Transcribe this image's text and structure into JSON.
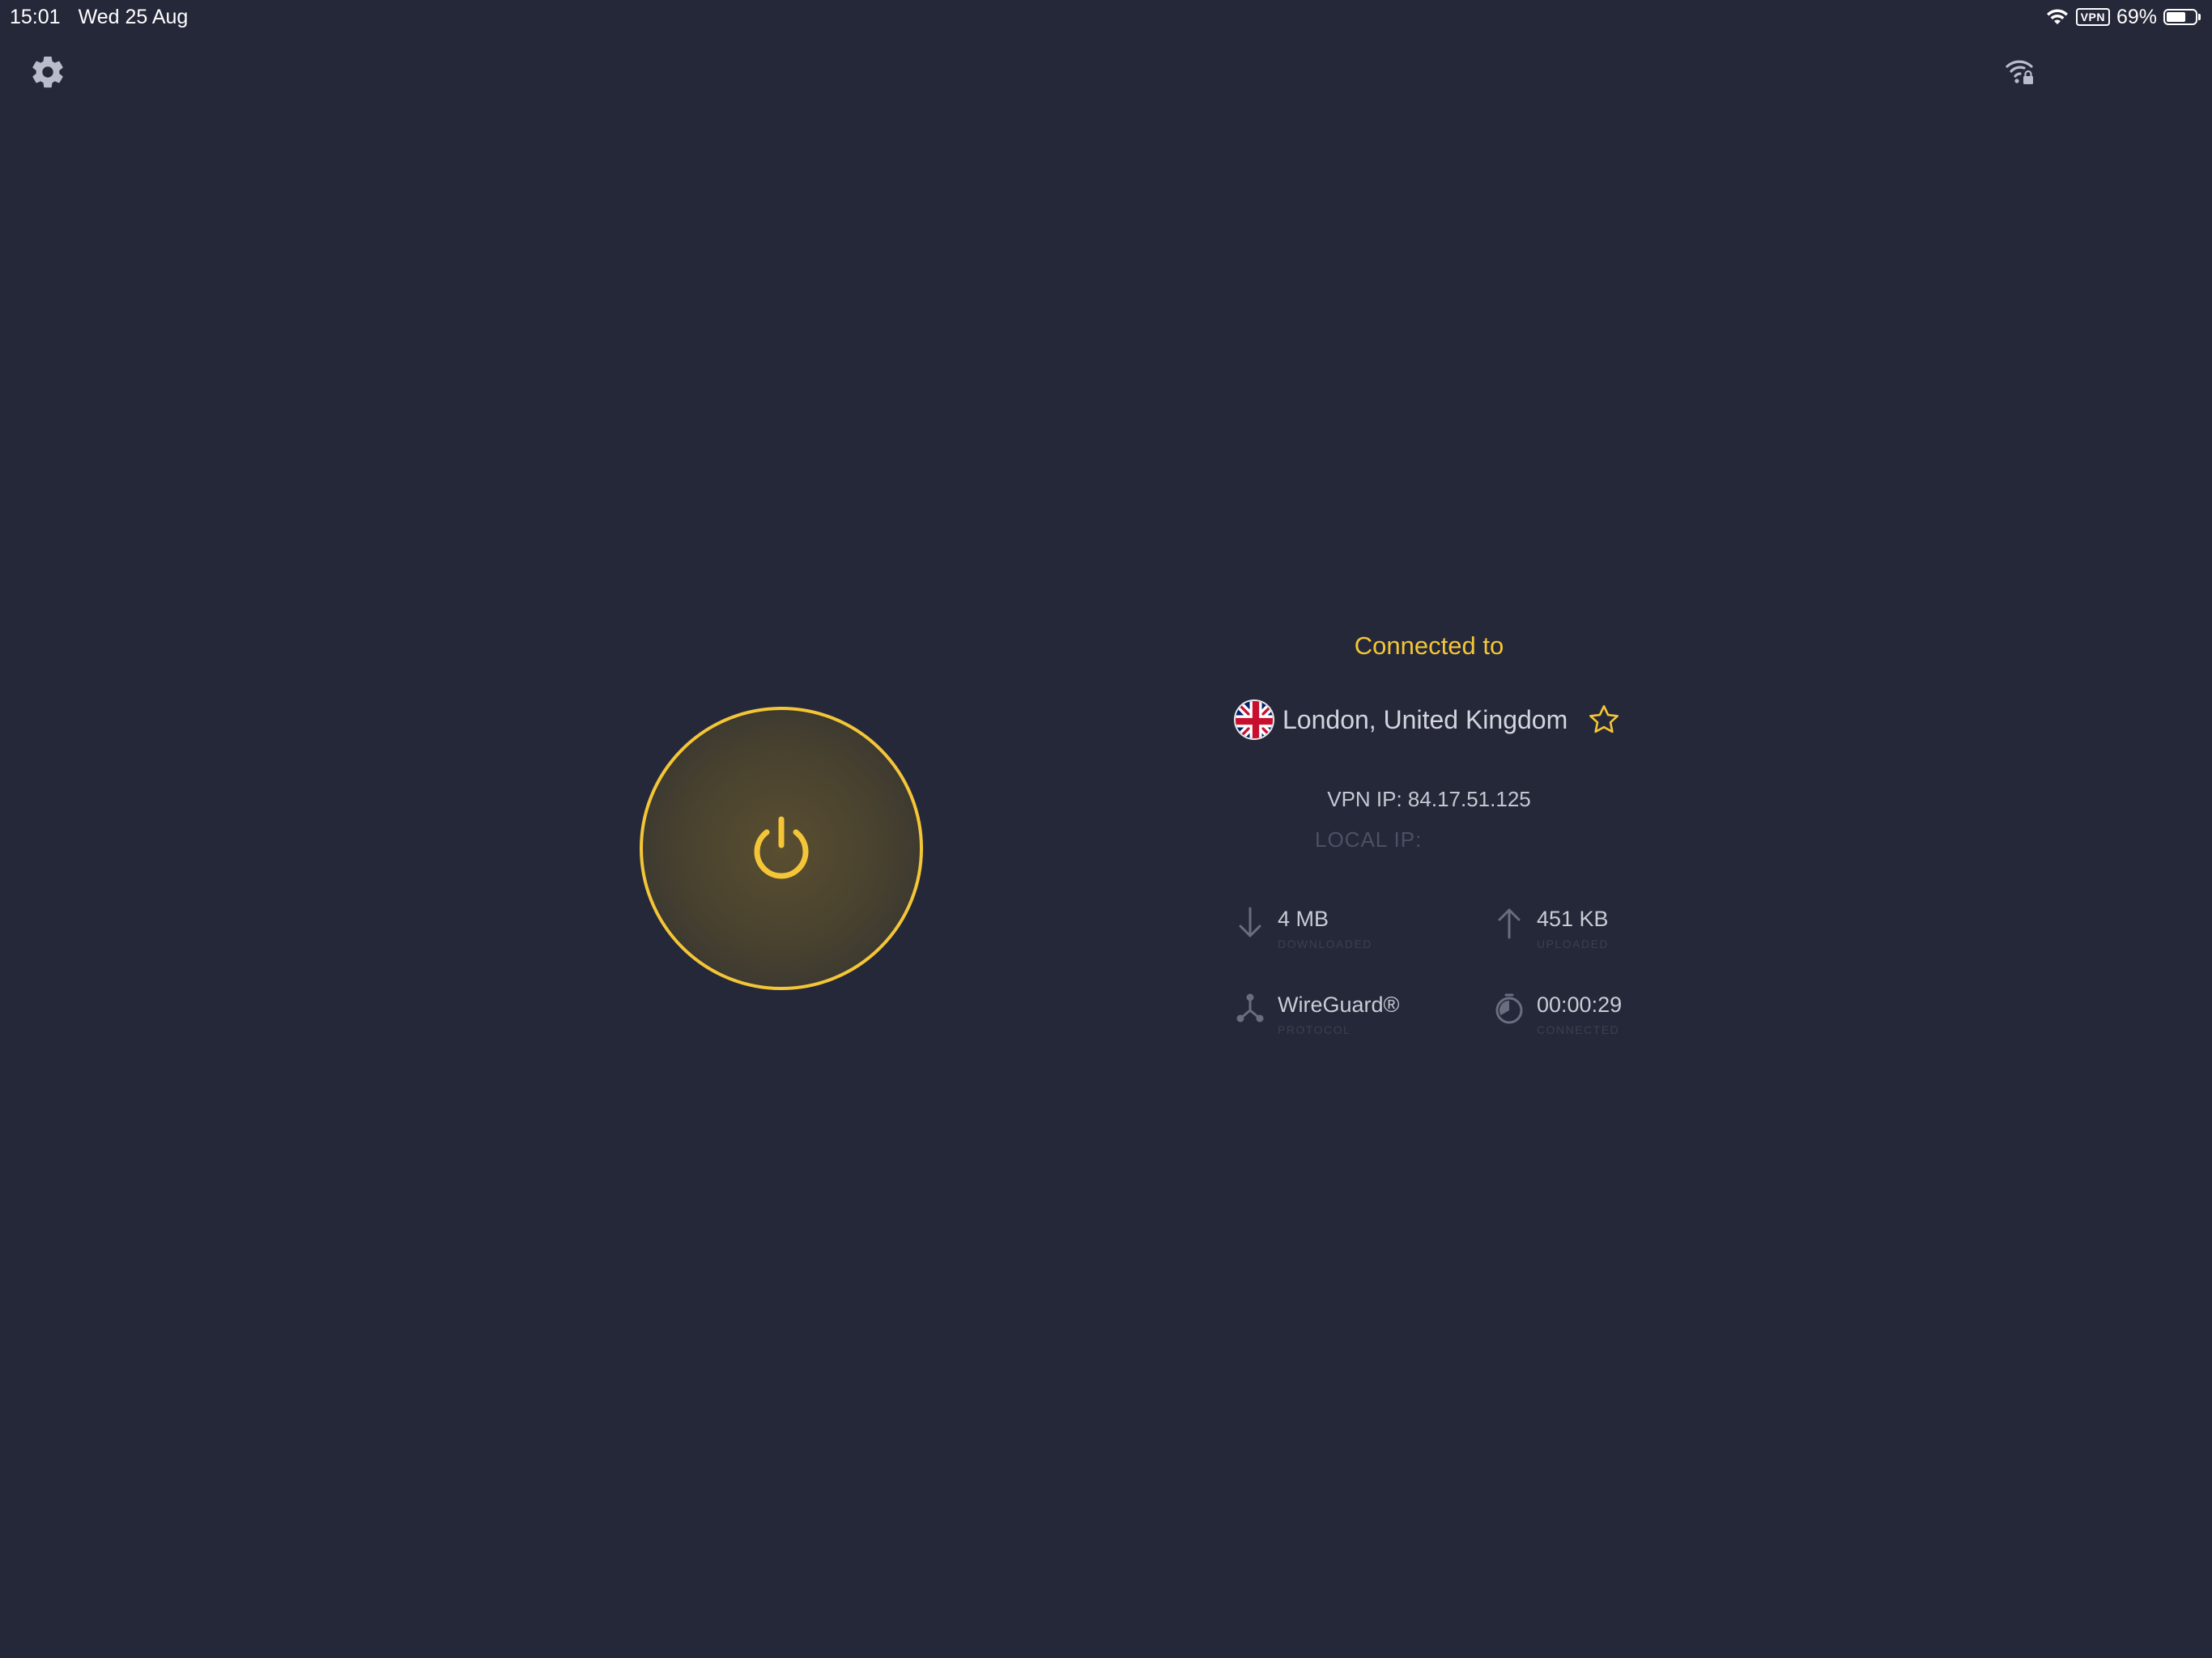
{
  "status_bar": {
    "time": "15:01",
    "date": "Wed 25 Aug",
    "vpn_badge": "VPN",
    "battery_percent": "69%",
    "battery_level": 0.69
  },
  "toolbar": {
    "settings_icon": "gear-icon",
    "network_icon": "wifi-lock-icon"
  },
  "connection": {
    "status_text": "Connected to",
    "location": "London, United Kingdom",
    "flag_icon": "uk-flag-icon",
    "favorite_icon": "star-outline-icon",
    "vpn_ip": "VPN IP: 84.17.51.125",
    "local_ip": "LOCAL IP:"
  },
  "stats": {
    "downloaded": {
      "value": "4 MB",
      "label": "DOWNLOADED",
      "icon": "arrow-down-icon"
    },
    "uploaded": {
      "value": "451 KB",
      "label": "UPLOADED",
      "icon": "arrow-up-icon"
    },
    "protocol": {
      "value": "WireGuard®",
      "label": "PROTOCOL",
      "icon": "protocol-icon"
    },
    "connected": {
      "value": "00:00:29",
      "label": "CONNECTED",
      "icon": "timer-icon"
    }
  },
  "colors": {
    "background": "#252839",
    "accent": "#f4c637",
    "text": "#c8cad6",
    "muted": "#4d5063"
  }
}
